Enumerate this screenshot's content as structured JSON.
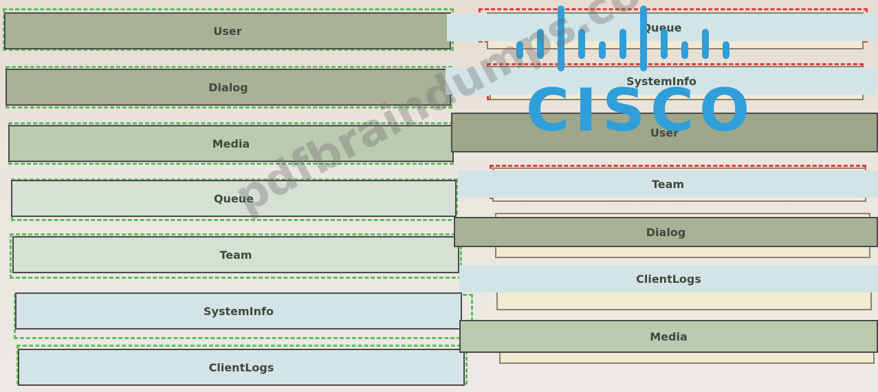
{
  "left_items": [
    {
      "label": "User"
    },
    {
      "label": "Dialog"
    },
    {
      "label": "Media"
    },
    {
      "label": "Queue"
    },
    {
      "label": "Team"
    },
    {
      "label": "SystemInfo"
    },
    {
      "label": "ClientLogs"
    }
  ],
  "right_items": [
    {
      "label": "Queue"
    },
    {
      "label": "SystemInfo"
    },
    {
      "label": "User"
    },
    {
      "label": "Team"
    },
    {
      "label": "Dialog"
    },
    {
      "label": "ClientLogs"
    },
    {
      "label": "Media"
    }
  ],
  "logo": {
    "text": "CISCO",
    "color": "#2f9ed9"
  },
  "watermark": {
    "text": "pdfbraindumps.com"
  },
  "colors": {
    "source_dash": "#5cbf5c",
    "target_dash": "#e23b3b"
  }
}
